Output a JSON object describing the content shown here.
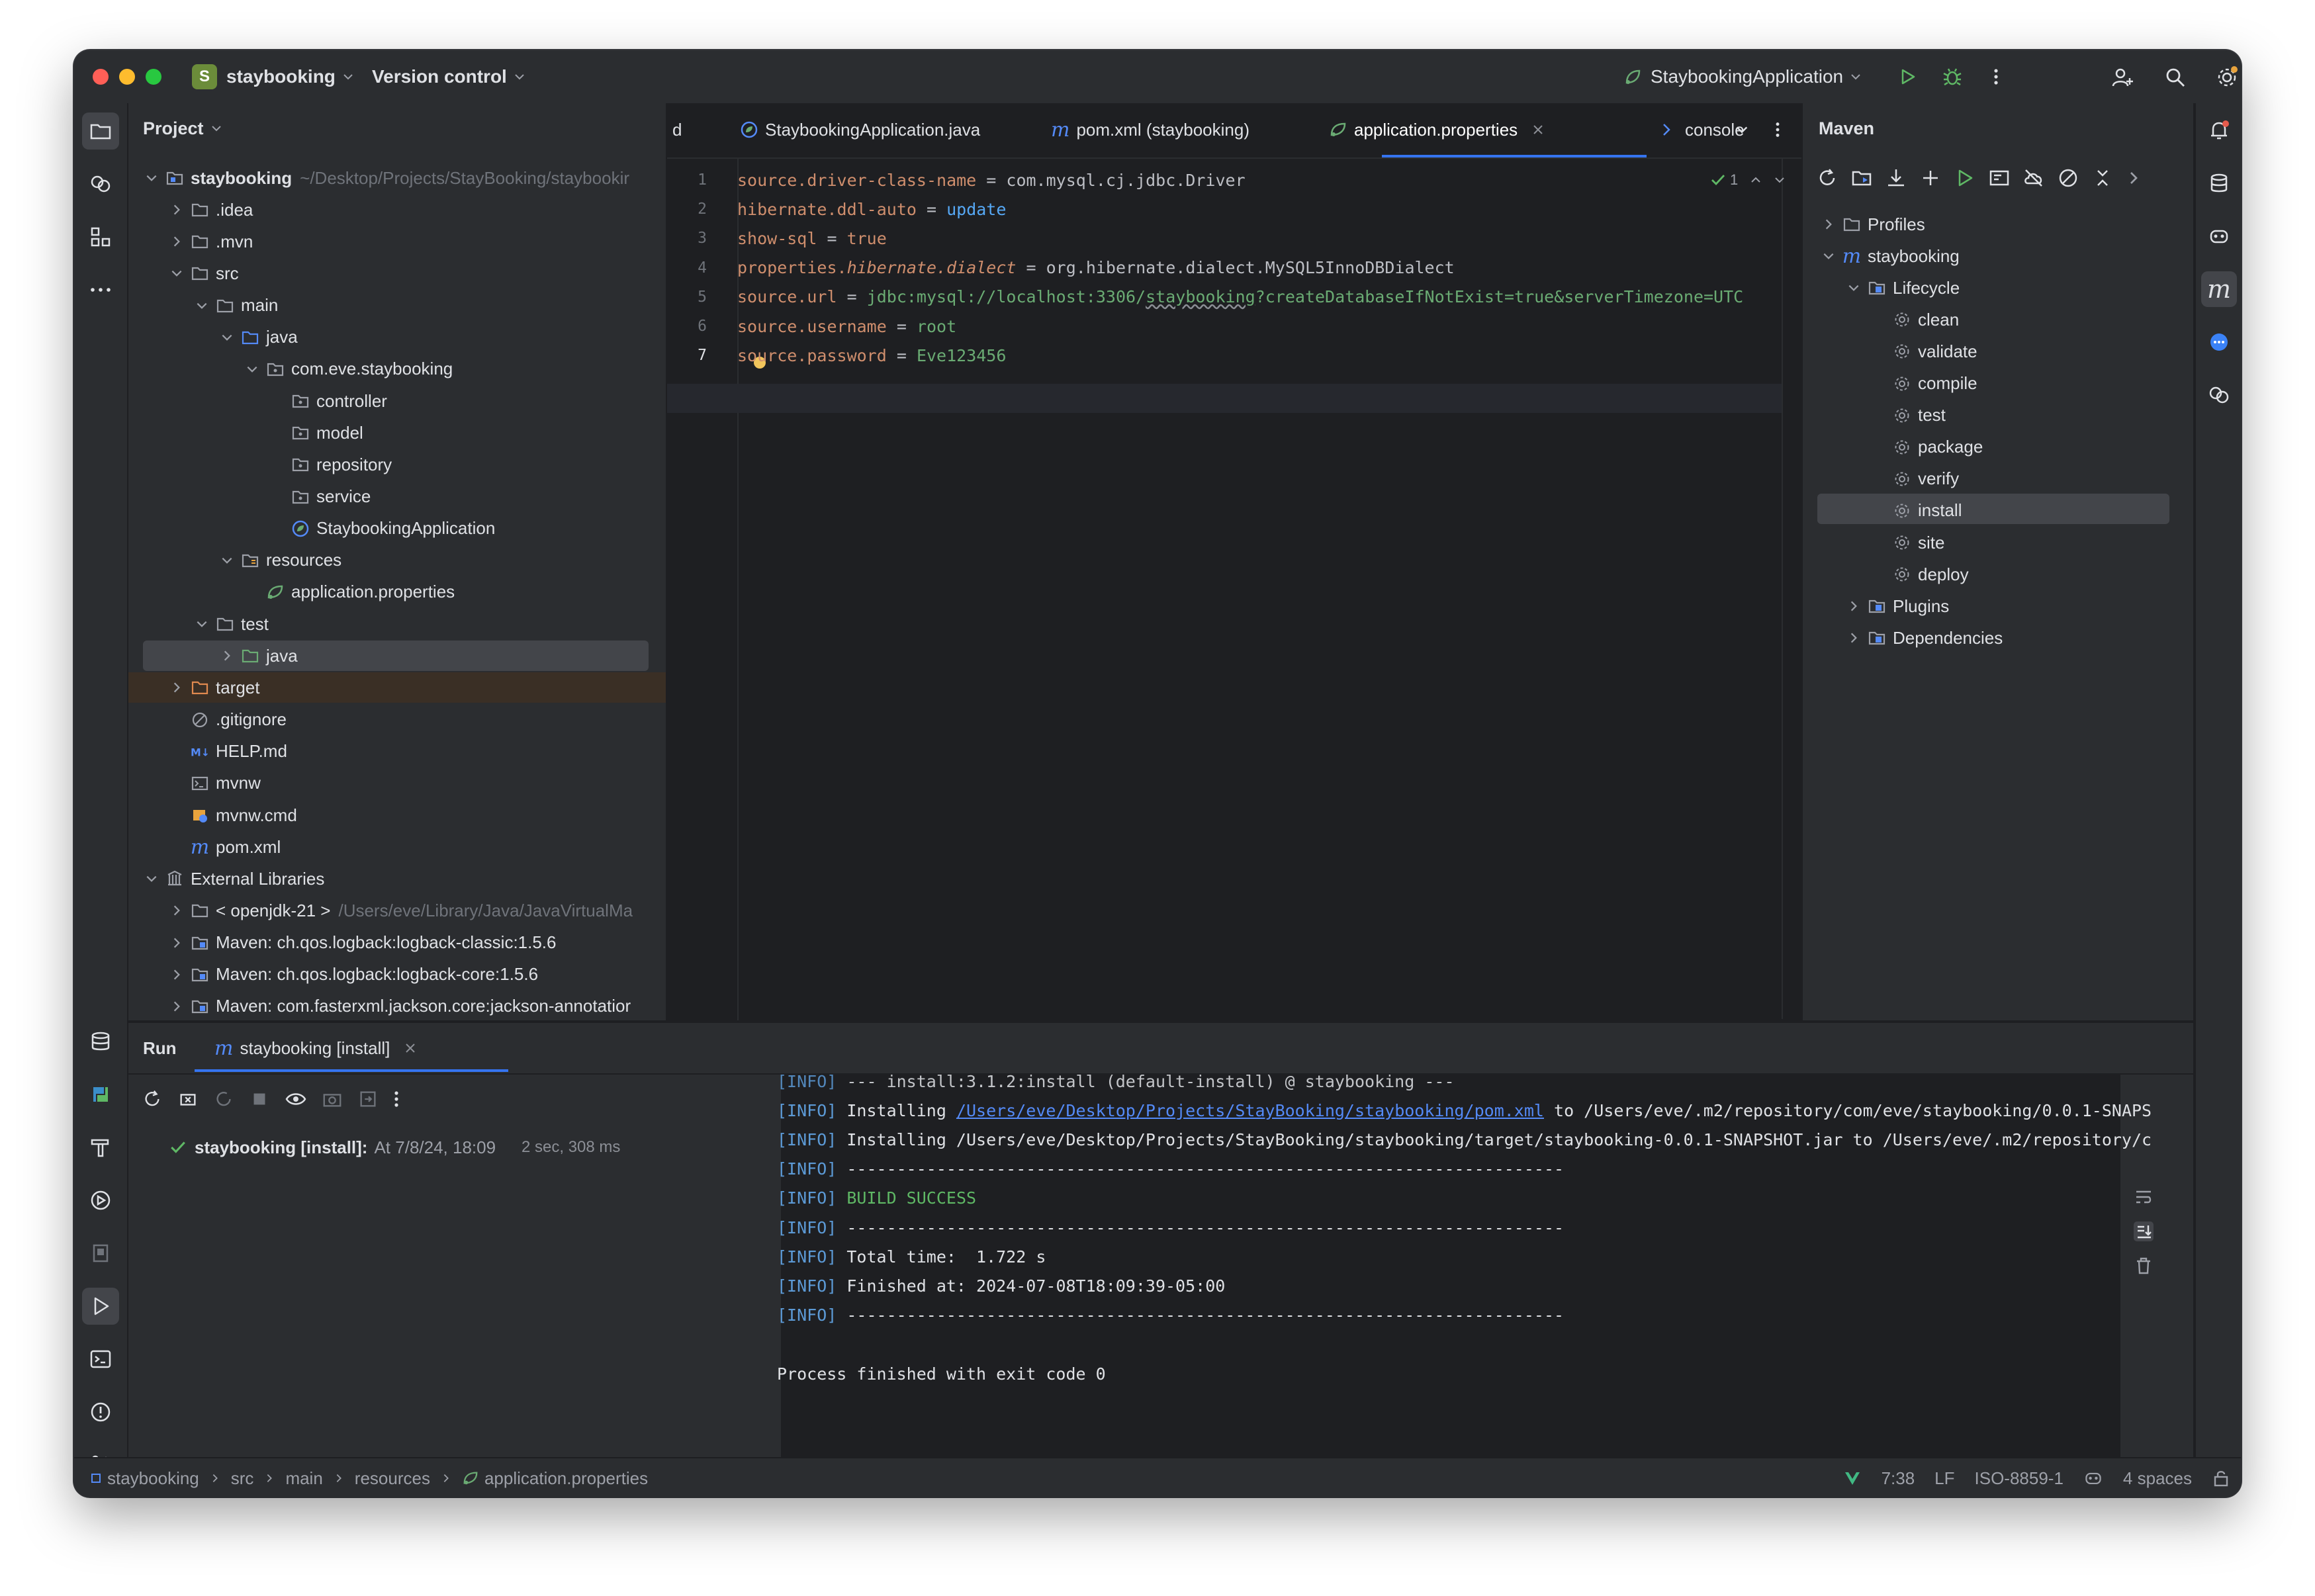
{
  "titlebar": {
    "project_badge": "S",
    "project_name": "staybooking",
    "vcs_label": "Version control",
    "run_config": "StaybookingApplication"
  },
  "project_panel": {
    "title": "Project",
    "tree": [
      {
        "label": "staybooking",
        "hint": "~/Desktop/Projects/StayBooking/staybookir",
        "bold": true
      },
      {
        "label": ".idea"
      },
      {
        "label": ".mvn"
      },
      {
        "label": "src"
      },
      {
        "label": "main"
      },
      {
        "label": "java"
      },
      {
        "label": "com.eve.staybooking"
      },
      {
        "label": "controller"
      },
      {
        "label": "model"
      },
      {
        "label": "repository"
      },
      {
        "label": "service"
      },
      {
        "label": "StaybookingApplication"
      },
      {
        "label": "resources"
      },
      {
        "label": "application.properties"
      },
      {
        "label": "test"
      },
      {
        "label": "java"
      },
      {
        "label": "target"
      },
      {
        "label": ".gitignore"
      },
      {
        "label": "HELP.md"
      },
      {
        "label": "mvnw"
      },
      {
        "label": "mvnw.cmd"
      },
      {
        "label": "pom.xml"
      },
      {
        "label": "External Libraries"
      },
      {
        "label": "< openjdk-21 >",
        "hint": "/Users/eve/Library/Java/JavaVirtualMa"
      },
      {
        "label": "Maven: ch.qos.logback:logback-classic:1.5.6"
      },
      {
        "label": "Maven: ch.qos.logback:logback-core:1.5.6"
      },
      {
        "label": "Maven: com.fasterxml.jackson.core:jackson-annotatior"
      }
    ]
  },
  "editor": {
    "tabs": [
      {
        "label": "d"
      },
      {
        "label": "StaybookingApplication.java"
      },
      {
        "label": "pom.xml (staybooking)"
      },
      {
        "label": "application.properties",
        "active": true
      },
      {
        "label": "console"
      }
    ],
    "inspection_count": "1",
    "lines": [
      {
        "num": "1",
        "key": "source.driver-class-name",
        "value": "com.mysql.cj.jdbc.Driver"
      },
      {
        "num": "2",
        "key": "hibernate.ddl-auto",
        "value": "update"
      },
      {
        "num": "3",
        "key": "show-sql",
        "value": "true"
      },
      {
        "num": "4",
        "key_a": "properties.",
        "key_b": "hibernate.dialect",
        "value": "org.hibernate.dialect.MySQL5InnoDBDialect"
      },
      {
        "num": "5",
        "key": "source.url",
        "value_a": "jdbc:mysql://localhost:3306/",
        "value_b": "staybooking",
        "value_c": "?createDatabaseIfNotExist=true&serverTimezone=UTC"
      },
      {
        "num": "6",
        "key": "source.username",
        "value": "root"
      },
      {
        "num": "7",
        "key": "source.password",
        "value": "Eve123456"
      }
    ]
  },
  "maven": {
    "title": "Maven",
    "items": [
      {
        "label": "Profiles"
      },
      {
        "label": "staybooking"
      },
      {
        "label": "Lifecycle"
      },
      {
        "label": "clean"
      },
      {
        "label": "validate"
      },
      {
        "label": "compile"
      },
      {
        "label": "test"
      },
      {
        "label": "package"
      },
      {
        "label": "verify"
      },
      {
        "label": "install"
      },
      {
        "label": "site"
      },
      {
        "label": "deploy"
      },
      {
        "label": "Plugins"
      },
      {
        "label": "Dependencies"
      }
    ]
  },
  "run_panel": {
    "tab_run": "Run",
    "tab_config": "staybooking [install]",
    "tree_title": "staybooking [install]:",
    "tree_time": "At 7/8/24, 18:09",
    "tree_duration": "2 sec, 308 ms",
    "console": [
      {
        "tag": "[INFO]",
        "text": " --- install:3.1.2:install (default-install) @ staybooking ---"
      },
      {
        "tag": "[INFO]",
        "text": " Installing ",
        "link": "/Users/eve/Desktop/Projects/StayBooking/staybooking/pom.xml",
        "rest": " to /Users/eve/.m2/repository/com/eve/staybooking/0.0.1-SNAPS"
      },
      {
        "tag": "[INFO]",
        "text": " Installing /Users/eve/Desktop/Projects/StayBooking/staybooking/target/staybooking-0.0.1-SNAPSHOT.jar to /Users/eve/.m2/repository/c"
      },
      {
        "tag": "[INFO]",
        "text": " ------------------------------------------------------------------------"
      },
      {
        "tag": "[INFO]",
        "text": " ",
        "success": "BUILD SUCCESS"
      },
      {
        "tag": "[INFO]",
        "text": " ------------------------------------------------------------------------"
      },
      {
        "tag": "[INFO]",
        "text": " Total time:  1.722 s"
      },
      {
        "tag": "[INFO]",
        "text": " Finished at: 2024-07-08T18:09:39-05:00"
      },
      {
        "tag": "[INFO]",
        "text": " ------------------------------------------------------------------------"
      }
    ],
    "exit_line": "Process finished with exit code 0"
  },
  "statusbar": {
    "breadcrumb": [
      "staybooking",
      "src",
      "main",
      "resources",
      "application.properties"
    ],
    "position": "7:38",
    "line_sep": "LF",
    "encoding": "ISO-8859-1",
    "indent": "4 spaces"
  },
  "colors": {
    "accent": "#3574f0",
    "key": "#cf8e6d",
    "value": "#6aab73",
    "keyword": "#56a8f5",
    "success": "#5fb865"
  }
}
